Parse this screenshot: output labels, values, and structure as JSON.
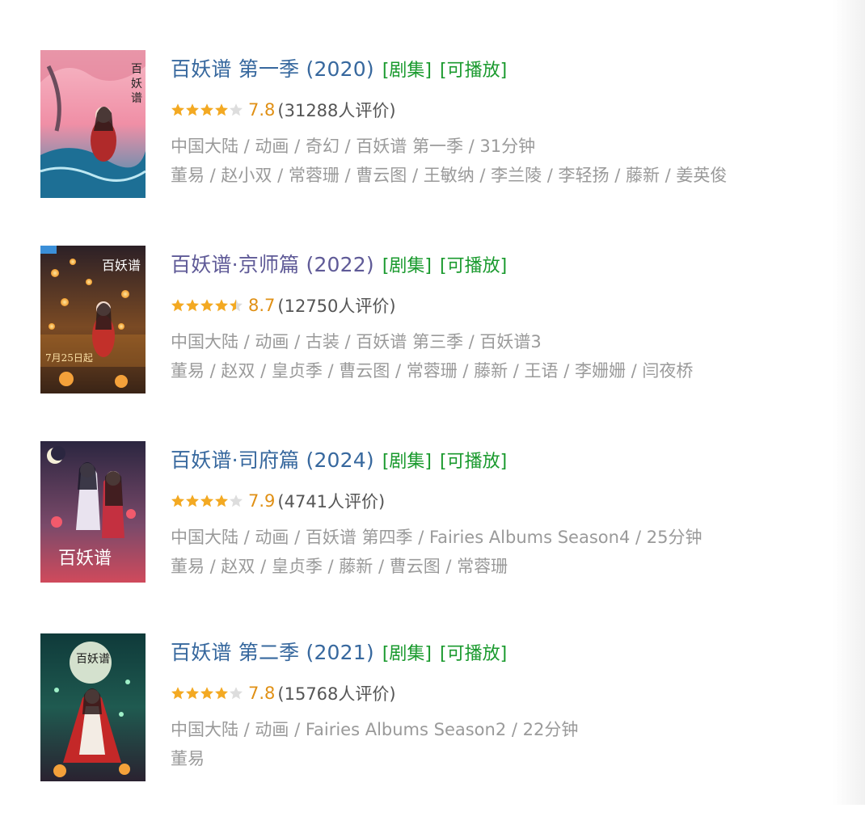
{
  "colors": {
    "title": "#37689e",
    "title_visited": "#5f5a97",
    "tag": "#1a9a2e",
    "score": "#e09015",
    "star_on": "#f3a922",
    "star_off": "#dddddd",
    "meta": "#9a9a9a"
  },
  "items": [
    {
      "title": "百妖谱 第一季 (2020)",
      "tag_type": "[剧集]",
      "tag_play": "[可播放]",
      "stars": 4,
      "score": "7.8",
      "count": "(31288人评价)",
      "info": "中国大陆 / 动画 / 奇幻 / 百妖谱 第一季 / 31分钟",
      "cast": "董易 / 赵小双 / 常蓉珊 / 曹云图 / 王敏纳 / 李兰陵 / 李轻扬 / 藤新 / 姜英俊",
      "poster_icon": "poster-image"
    },
    {
      "title": "百妖谱·京师篇 (2022)",
      "tag_type": "[剧集]",
      "tag_play": "[可播放]",
      "stars": 4.5,
      "score": "8.7",
      "count": "(12750人评价)",
      "info": "中国大陆 / 动画 / 古装 / 百妖谱 第三季 / 百妖谱3",
      "cast": "董易 / 赵双 / 皇贞季 / 曹云图 / 常蓉珊 / 藤新 / 王语 / 李姗姗 / 闫夜桥",
      "poster_icon": "poster-image"
    },
    {
      "title": "百妖谱·司府篇 (2024)",
      "tag_type": "[剧集]",
      "tag_play": "[可播放]",
      "stars": 4,
      "score": "7.9",
      "count": "(4741人评价)",
      "info": "中国大陆 / 动画 / 百妖谱 第四季 / Fairies Albums Season4 / 25分钟",
      "cast": "董易 / 赵双 / 皇贞季 / 藤新 / 曹云图 / 常蓉珊",
      "poster_icon": "poster-image"
    },
    {
      "title": "百妖谱 第二季 (2021)",
      "tag_type": "[剧集]",
      "tag_play": "[可播放]",
      "stars": 4,
      "score": "7.8",
      "count": "(15768人评价)",
      "info": "中国大陆 / 动画 / Fairies Albums Season2 / 22分钟",
      "cast": "董易",
      "poster_icon": "poster-image"
    }
  ]
}
